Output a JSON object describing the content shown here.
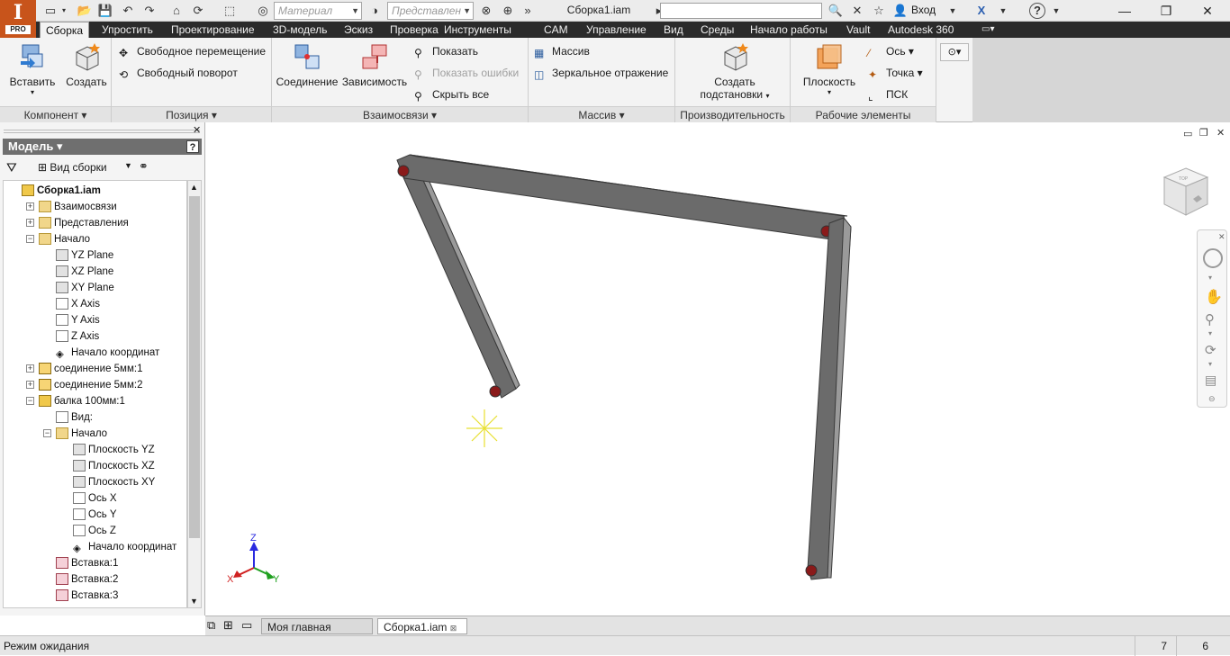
{
  "app": {
    "logo_letter": "I",
    "logo_badge": "PRO",
    "document_title": "Сборка1.iam",
    "material_combo": "Материал",
    "appearance_combo": "Представлен",
    "login_label": "Вход",
    "help_label": "?"
  },
  "tabs": [
    "Сборка",
    "Упростить",
    "Проектирование",
    "3D-модель",
    "Эскиз",
    "Проверка",
    "Инструменты",
    "CAM",
    "Управление",
    "Вид",
    "Среды",
    "Начало работы",
    "Vault",
    "Autodesk 360"
  ],
  "ribbon": {
    "component": {
      "insert": "Вставить",
      "create": "Создать",
      "label": "Компонент"
    },
    "position": {
      "free_move": "Свободное перемещение",
      "free_rotate": "Свободный поворот",
      "label": "Позиция"
    },
    "relationships": {
      "joint": "Соединение",
      "constraint": "Зависимость",
      "show": "Показать",
      "show_errors": "Показать ошибки",
      "hide_all": "Скрыть все",
      "label": "Взаимосвязи"
    },
    "pattern": {
      "pattern": "Массив",
      "mirror": "Зеркальное отражение",
      "label": "Массив"
    },
    "productivity": {
      "create_sub_line1": "Создать",
      "create_sub_line2": "подстановки",
      "label": "Производительность"
    },
    "work_features": {
      "plane": "Плоскость",
      "axis": "Ось",
      "point": "Точка",
      "ucs": "ПСК",
      "label": "Рабочие элементы"
    }
  },
  "browser": {
    "title": "Модель",
    "view_label": "Вид сборки",
    "tree": [
      {
        "label": "Сборка1.iam",
        "level": 0,
        "icon": "asm",
        "expander": "",
        "bold": true
      },
      {
        "label": "Взаимосвязи",
        "level": 1,
        "icon": "folder",
        "expander": "+"
      },
      {
        "label": "Представления",
        "level": 1,
        "icon": "folder",
        "expander": "+"
      },
      {
        "label": "Начало",
        "level": 1,
        "icon": "folder",
        "expander": "-"
      },
      {
        "label": "YZ Plane",
        "level": 2,
        "icon": "plane",
        "expander": ""
      },
      {
        "label": "XZ Plane",
        "level": 2,
        "icon": "plane",
        "expander": ""
      },
      {
        "label": "XY Plane",
        "level": 2,
        "icon": "plane",
        "expander": ""
      },
      {
        "label": "X Axis",
        "level": 2,
        "icon": "axis",
        "expander": ""
      },
      {
        "label": "Y Axis",
        "level": 2,
        "icon": "axis",
        "expander": ""
      },
      {
        "label": "Z Axis",
        "level": 2,
        "icon": "axis",
        "expander": ""
      },
      {
        "label": "Начало координат",
        "level": 2,
        "icon": "pt",
        "expander": ""
      },
      {
        "label": "соединение 5мм:1",
        "level": 1,
        "icon": "joint",
        "expander": "+"
      },
      {
        "label": "соединение 5мм:2",
        "level": 1,
        "icon": "joint",
        "expander": "+"
      },
      {
        "label": "балка 100мм:1",
        "level": 1,
        "icon": "asm",
        "expander": "-"
      },
      {
        "label": "Вид:",
        "level": 2,
        "icon": "axis",
        "expander": ""
      },
      {
        "label": "Начало",
        "level": 2,
        "icon": "folder",
        "expander": "-"
      },
      {
        "label": "Плоскость YZ",
        "level": 3,
        "icon": "plane",
        "expander": ""
      },
      {
        "label": "Плоскость XZ",
        "level": 3,
        "icon": "plane",
        "expander": ""
      },
      {
        "label": "Плоскость XY",
        "level": 3,
        "icon": "plane",
        "expander": ""
      },
      {
        "label": "Ось X",
        "level": 3,
        "icon": "axis",
        "expander": ""
      },
      {
        "label": "Ось Y",
        "level": 3,
        "icon": "axis",
        "expander": ""
      },
      {
        "label": "Ось Z",
        "level": 3,
        "icon": "axis",
        "expander": ""
      },
      {
        "label": "Начало координат",
        "level": 3,
        "icon": "pt",
        "expander": ""
      },
      {
        "label": "Вставка:1",
        "level": 2,
        "icon": "ins",
        "expander": ""
      },
      {
        "label": "Вставка:2",
        "level": 2,
        "icon": "ins",
        "expander": ""
      },
      {
        "label": "Вставка:3",
        "level": 2,
        "icon": "ins",
        "expander": ""
      }
    ]
  },
  "triad": {
    "x": "X",
    "y": "Y",
    "z": "Z"
  },
  "doc_tabs": [
    "Моя главная стран...",
    "Сборка1.iam"
  ],
  "status": {
    "text": "Режим ожидания",
    "count1": "7",
    "count2": "6"
  },
  "colors": {
    "tab_bar": "#2b2b2b",
    "beam": "#6b6b6b",
    "hole": "#8a1a1a",
    "logo": "#c8541b"
  }
}
